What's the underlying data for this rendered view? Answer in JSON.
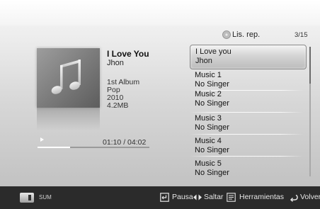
{
  "now_playing": {
    "title": "I Love You",
    "artist": "Jhon",
    "album": "1st Album",
    "genre": "Pop",
    "year": "2010",
    "size": "4.2MB",
    "time_display": "01:10 / 04:02",
    "progress_fraction": 0.29,
    "album_art_icon": "music-note-icon"
  },
  "playlist": {
    "header_label": "Lis. rep.",
    "header_icon": "playlist-disc-icon",
    "counter": "3/15",
    "items": [
      {
        "title": "I Love you",
        "artist": "Jhon",
        "selected": true
      },
      {
        "title": "Music 1",
        "artist": "No Singer",
        "selected": false
      },
      {
        "title": "Music 2",
        "artist": "No Singer",
        "selected": false
      },
      {
        "title": "Music 3",
        "artist": "No Singer",
        "selected": false
      },
      {
        "title": "Music 4",
        "artist": "No Singer",
        "selected": false
      },
      {
        "title": "Music 5",
        "artist": "No Singer",
        "selected": false
      }
    ]
  },
  "bottom_bar": {
    "sum_label": "SUM",
    "pause_label": "Pausa",
    "skip_label": "Saltar",
    "tools_label": "Herramientas",
    "back_label": "Volver"
  },
  "colors": {
    "background_top": "#f6f6f6",
    "background_bottom": "#c2c2c2",
    "bottom_bar": "#2b2b2b",
    "selection_border": "#8a8a8a"
  }
}
